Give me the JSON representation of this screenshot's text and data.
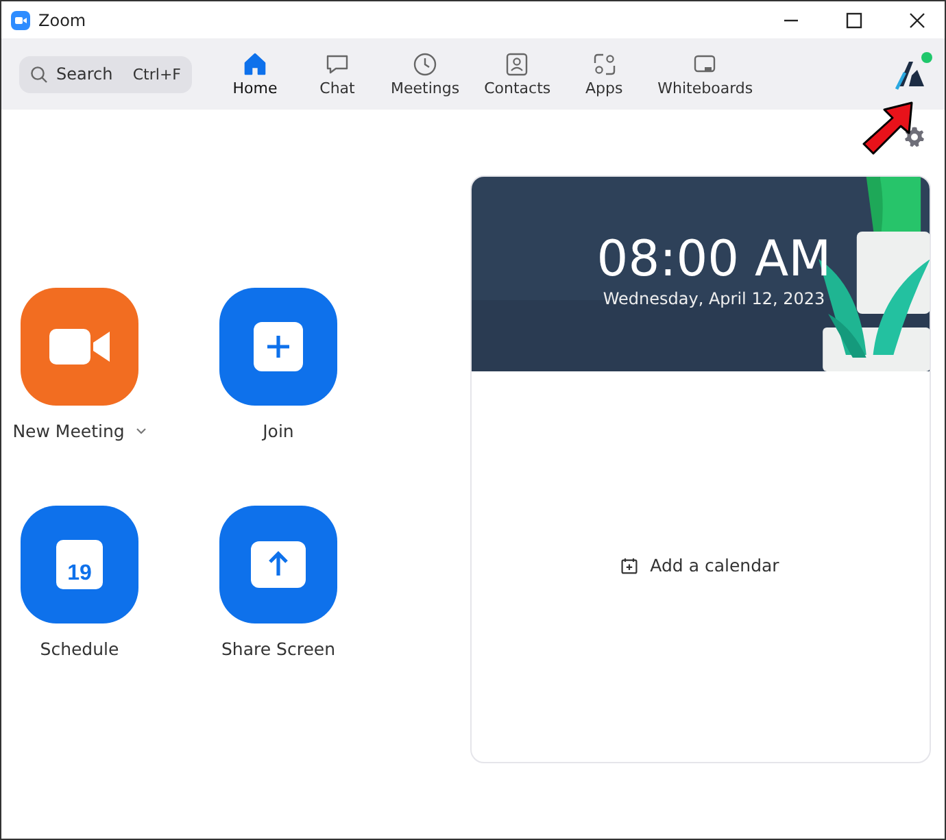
{
  "window": {
    "title": "Zoom"
  },
  "search": {
    "placeholder": "Search",
    "shortcut": "Ctrl+F"
  },
  "tabs": [
    {
      "label": "Home",
      "kind": "home",
      "selected": true
    },
    {
      "label": "Chat",
      "kind": "chat",
      "selected": false
    },
    {
      "label": "Meetings",
      "kind": "meetings",
      "selected": false
    },
    {
      "label": "Contacts",
      "kind": "contacts",
      "selected": false
    },
    {
      "label": "Apps",
      "kind": "apps",
      "selected": false
    },
    {
      "label": "Whiteboards",
      "kind": "whiteboards",
      "selected": false
    }
  ],
  "profile": {
    "online": true
  },
  "actions": [
    {
      "label": "New Meeting",
      "kind": "video",
      "color": "#f26d21",
      "dropdown": true
    },
    {
      "label": "Join",
      "kind": "join",
      "color": "#0e71eb",
      "dropdown": false
    },
    {
      "label": "Schedule",
      "kind": "calendar",
      "color": "#0e71eb",
      "dropdown": false,
      "icon_text": "19"
    },
    {
      "label": "Share Screen",
      "kind": "share",
      "color": "#0e71eb",
      "dropdown": false
    }
  ],
  "clock": {
    "time": "08:00 AM",
    "date": "Wednesday, April 12, 2023"
  },
  "calendar": {
    "link": "Add a calendar"
  }
}
